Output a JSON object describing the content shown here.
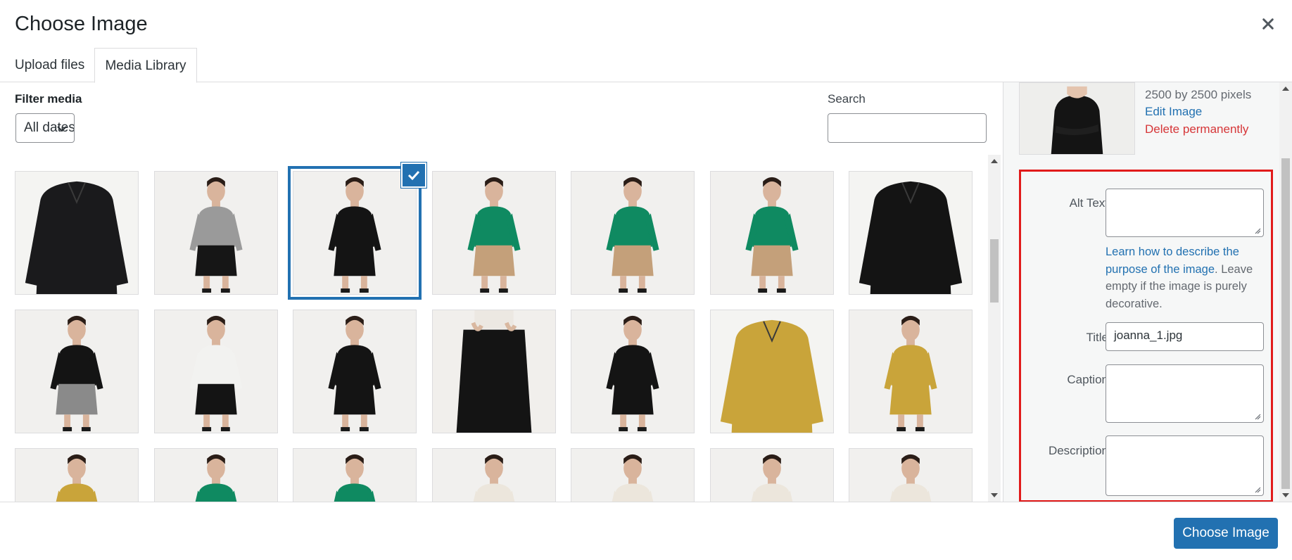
{
  "modal": {
    "title": "Choose Image"
  },
  "tabs": [
    {
      "label": "Upload files",
      "active": false
    },
    {
      "label": "Media Library",
      "active": true
    }
  ],
  "filters": {
    "label": "Filter media",
    "selected": "All dates",
    "search_label": "Search",
    "search_value": ""
  },
  "media_items": [
    {
      "subject": "black quilted jacket",
      "kind": "product",
      "garment": "#1a1a1c",
      "bottom": "#1a1a1c",
      "selected": false
    },
    {
      "subject": "model in grey sweater and black skirt",
      "kind": "model",
      "garment": "#9a9a9a",
      "bottom": "#161616",
      "selected": false
    },
    {
      "subject": "model in black long-sleeve top",
      "kind": "model",
      "garment": "#141414",
      "bottom": "#141414",
      "selected": true
    },
    {
      "subject": "model in green sweater side view",
      "kind": "model",
      "garment": "#0f8a61",
      "bottom": "#c4a07a",
      "selected": false
    },
    {
      "subject": "seated model in green sweater",
      "kind": "model",
      "garment": "#0f8a61",
      "bottom": "#c4a07a",
      "selected": false
    },
    {
      "subject": "model in green sweater",
      "kind": "model",
      "garment": "#0f8a61",
      "bottom": "#c4a07a",
      "selected": false
    },
    {
      "subject": "black cropped jacket",
      "kind": "product",
      "garment": "#141414",
      "bottom": "#141414",
      "selected": false
    },
    {
      "subject": "model seated on stool in black jacket",
      "kind": "model",
      "garment": "#141414",
      "bottom": "#8a8a8a",
      "selected": false
    },
    {
      "subject": "model in white top and black skirt",
      "kind": "model",
      "garment": "#f2f2f0",
      "bottom": "#141414",
      "selected": false
    },
    {
      "subject": "model in black turtleneck dress",
      "kind": "model",
      "garment": "#141414",
      "bottom": "#141414",
      "selected": false
    },
    {
      "subject": "black skirt close-up",
      "kind": "skirt",
      "garment": "#141414",
      "bottom": "#141414",
      "selected": false
    },
    {
      "subject": "model in black blazer and skirt",
      "kind": "model",
      "garment": "#141414",
      "bottom": "#141414",
      "selected": false
    },
    {
      "subject": "printed yellow shirt dress",
      "kind": "product",
      "garment": "#c9a43a",
      "bottom": "#c9a43a",
      "selected": false
    },
    {
      "subject": "model in printed yellow dress",
      "kind": "model",
      "garment": "#c9a43a",
      "bottom": "#c9a43a",
      "selected": false
    },
    {
      "subject": "model in printed yellow blouse",
      "kind": "model",
      "garment": "#c9a43a",
      "bottom": "#c9a43a",
      "selected": false
    },
    {
      "subject": "model with green earrings",
      "kind": "model",
      "garment": "#0f8a61",
      "bottom": "#0f8a61",
      "selected": false
    },
    {
      "subject": "model in green top arms raised",
      "kind": "model",
      "garment": "#0f8a61",
      "bottom": "#0f8a61",
      "selected": false
    },
    {
      "subject": "model in cream sweater",
      "kind": "model",
      "garment": "#ece6dc",
      "bottom": "#e2dccf",
      "selected": false
    },
    {
      "subject": "model in cream knit",
      "kind": "model",
      "garment": "#ece6dc",
      "bottom": "#e2dccf",
      "selected": false
    },
    {
      "subject": "model in cream sweater side",
      "kind": "model",
      "garment": "#ece6dc",
      "bottom": "#e2dccf",
      "selected": false
    },
    {
      "subject": "model in cream top",
      "kind": "model",
      "garment": "#ece6dc",
      "bottom": "#e2dccf",
      "selected": false
    }
  ],
  "attachment": {
    "dimensions": "2500 by 2500 pixels",
    "edit_label": "Edit Image",
    "delete_label": "Delete permanently",
    "alt_text_label": "Alt Text",
    "alt_text_value": "",
    "help_link": "Learn how to describe the purpose of the image",
    "help_rest": ". Leave empty if the image is purely decorative.",
    "title_label": "Title",
    "title_value": "joanna_1.jpg",
    "caption_label": "Caption",
    "caption_value": "",
    "description_label": "Description",
    "description_value": ""
  },
  "footer": {
    "choose_label": "Choose Image"
  },
  "colors": {
    "accent": "#2271b1",
    "danger": "#d63638",
    "highlight_box": "#e11b1b"
  },
  "icons": {
    "close": "close-icon",
    "check": "checkmark-icon",
    "dropdown": "chevron-down-icon"
  }
}
